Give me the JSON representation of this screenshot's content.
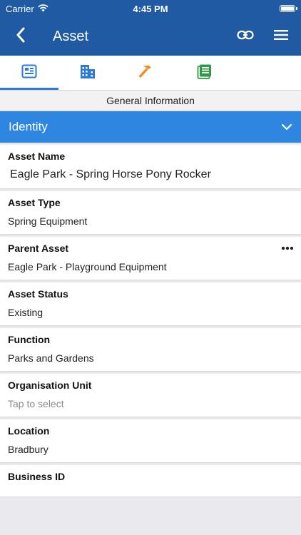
{
  "status": {
    "carrier": "Carrier",
    "time": "4:45 PM"
  },
  "nav": {
    "title": "Asset",
    "icons": [
      "back-chevron-icon",
      "link-icon",
      "menu-icon"
    ]
  },
  "tabs": [
    {
      "icon": "details-card-icon",
      "color": "#2a7ad6",
      "active": true
    },
    {
      "icon": "buildings-icon",
      "color": "#2a7ad6",
      "active": false
    },
    {
      "icon": "hammer-icon",
      "color": "#f08a1c",
      "active": false
    },
    {
      "icon": "notes-icon",
      "color": "#2f9a45",
      "active": false
    }
  ],
  "section": {
    "title": "General Information"
  },
  "group": {
    "title": "Identity"
  },
  "fields": [
    {
      "label": "Asset Name",
      "value": "Eagle Park - Spring Horse Pony Rocker"
    },
    {
      "label": "Asset Type",
      "value": "Spring Equipment"
    },
    {
      "label": "Parent Asset",
      "value": "Eagle Park - Playground Equipment"
    },
    {
      "label": "Asset Status",
      "value": "Existing"
    },
    {
      "label": "Function",
      "value": "Parks and Gardens"
    },
    {
      "label": "Organisation Unit",
      "placeholder": "Tap to select"
    },
    {
      "label": "Location",
      "value": "Bradbury"
    },
    {
      "label": "Business ID",
      "value": ""
    }
  ],
  "colors": {
    "nav_bg": "#1f5aa3",
    "group_bg": "#2f86e0",
    "accent": "#2a7ad6"
  }
}
